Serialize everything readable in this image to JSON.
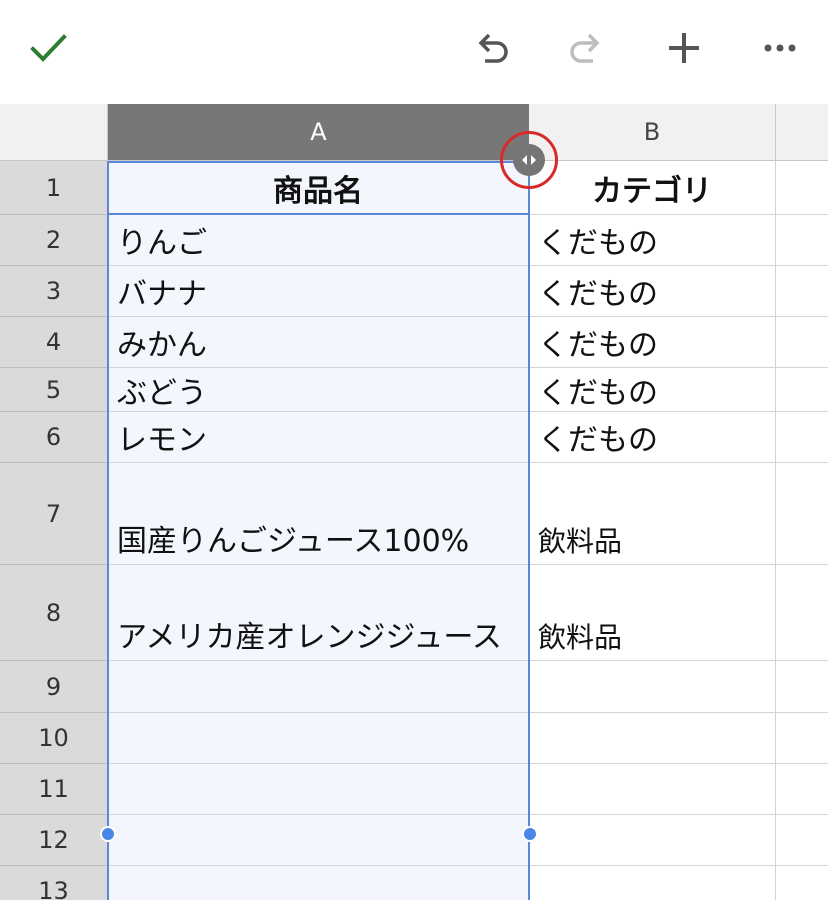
{
  "toolbar": {
    "done_icon": "checkmark-icon",
    "undo_icon": "undo-icon",
    "redo_icon": "redo-icon",
    "add_icon": "plus-icon",
    "more_icon": "more-icon",
    "accent": "#2e7d32"
  },
  "columns": [
    {
      "label": "A",
      "selected": true
    },
    {
      "label": "B",
      "selected": false
    }
  ],
  "rows": [
    {
      "num": "1",
      "a": "商品名",
      "b": "カテゴリ"
    },
    {
      "num": "2",
      "a": "りんご",
      "b": "くだもの"
    },
    {
      "num": "3",
      "a": "バナナ",
      "b": "くだもの"
    },
    {
      "num": "4",
      "a": "みかん",
      "b": "くだもの"
    },
    {
      "num": "5",
      "a": "ぶどう",
      "b": "くだもの"
    },
    {
      "num": "6",
      "a": "レモン",
      "b": "くだもの"
    },
    {
      "num": "7",
      "a": "国産りんごジュース100%",
      "b": "飲料品"
    },
    {
      "num": "8",
      "a": "アメリカ産オレンジジュース",
      "b": "飲料品"
    },
    {
      "num": "9",
      "a": "",
      "b": ""
    },
    {
      "num": "10",
      "a": "",
      "b": ""
    },
    {
      "num": "11",
      "a": "",
      "b": ""
    },
    {
      "num": "12",
      "a": "",
      "b": ""
    },
    {
      "num": "13",
      "a": "",
      "b": ""
    }
  ],
  "colors": {
    "selection": "#5b87d6",
    "selected_header": "#777777",
    "highlight_ring": "#d82a2a"
  }
}
